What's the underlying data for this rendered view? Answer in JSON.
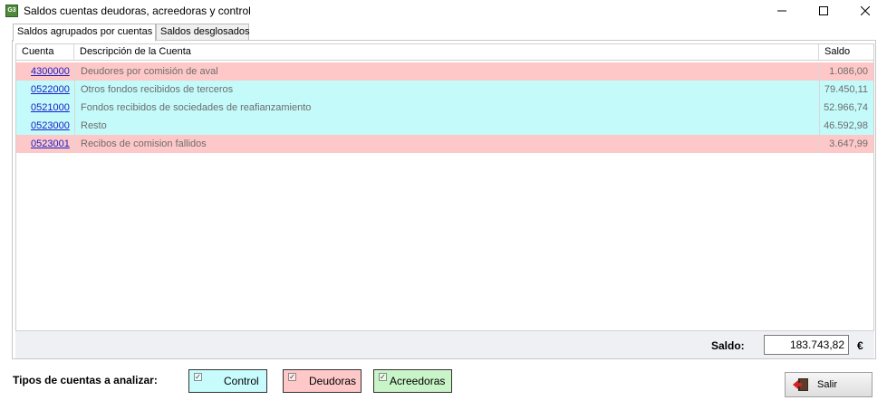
{
  "window": {
    "icon_text": "G3",
    "title": "Saldos cuentas deudoras, acreedoras y control"
  },
  "tabs": [
    {
      "label": "Saldos agrupados por cuentas",
      "active": true
    },
    {
      "label": "Saldos desglosados",
      "active": false
    }
  ],
  "grid": {
    "columns": [
      "Cuenta",
      "Descripción de la Cuenta",
      "Saldo"
    ],
    "rows": [
      {
        "cuenta": "4300000",
        "descripcion": "Deudores por comisión de aval",
        "saldo": "1.086,00",
        "tipo": "deudora"
      },
      {
        "cuenta": "0522000",
        "descripcion": "Otros fondos recibidos de terceros",
        "saldo": "79.450,11",
        "tipo": "control"
      },
      {
        "cuenta": "0521000",
        "descripcion": "Fondos recibidos de sociedades de reafianzamiento",
        "saldo": "52.966,74",
        "tipo": "control"
      },
      {
        "cuenta": "0523000",
        "descripcion": "Resto",
        "saldo": "46.592,98",
        "tipo": "control"
      },
      {
        "cuenta": "0523001",
        "descripcion": "Recibos de comision fallidos",
        "saldo": "3.647,99",
        "tipo": "deudora"
      }
    ]
  },
  "total": {
    "label": "Saldo:",
    "value": "183.743,82",
    "unit": "€"
  },
  "filters": {
    "label": "Tipos de cuentas a analizar:",
    "options": [
      {
        "label": "Control",
        "checked": true,
        "color": "#c8fcfc"
      },
      {
        "label": "Deudoras",
        "checked": true,
        "color": "#ffc8c8"
      },
      {
        "label": "Acreedoras",
        "checked": true,
        "color": "#c8f4c8"
      }
    ]
  },
  "colors": {
    "deudora": "#ffc8c8",
    "control": "#c4fafa",
    "acreedora": "#c8f4c8",
    "link": "#1a20c8"
  },
  "buttons": {
    "salir": "Salir"
  }
}
